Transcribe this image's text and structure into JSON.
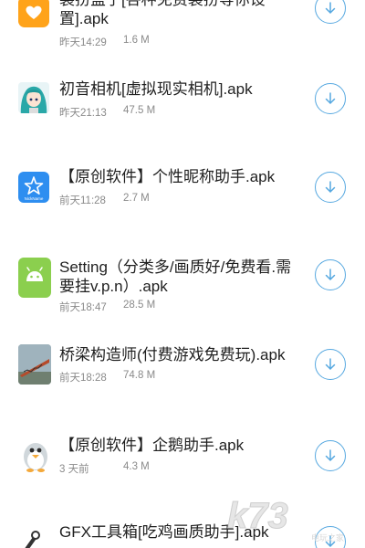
{
  "colors": {
    "accent": "#56a8e0",
    "title_text": "#1f1f1f",
    "meta_text": "#8a8a8a",
    "icon_heart_bg": "#ffa31a",
    "icon_star_bg": "#2e8ef0",
    "icon_android_bg": "#8bcf4e"
  },
  "apps": [
    {
      "title": "装扮盒子[各种免费装扮等你设置].apk",
      "time": "昨天14:29",
      "size": "1.6 M",
      "icon": "heart-icon"
    },
    {
      "title": "初音相机[虚拟现实相机].apk",
      "time": "昨天21:13",
      "size": "47.5 M",
      "icon": "hatsune-avatar-icon"
    },
    {
      "title": "【原创软件】个性昵称助手.apk",
      "time": "前天11:28",
      "size": "2.7 M",
      "icon": "nickname-star-icon",
      "icon_caption": "NickName"
    },
    {
      "title": "Setting（分类多/画质好/免费看.需要挂v.p.n）.apk",
      "time": "前天18:47",
      "size": "28.5 M",
      "icon": "android-icon"
    },
    {
      "title": "桥梁构造师(付费游戏免费玩).apk",
      "time": "前天18:28",
      "size": "74.8 M",
      "icon": "bridge-game-icon"
    },
    {
      "title": "【原创软件】企鹅助手.apk",
      "time": "3 天前",
      "size": "4.3 M",
      "icon": "penguin-icon"
    },
    {
      "title": "GFX工具箱[吃鸡画质助手].apk",
      "time": "",
      "size": "",
      "icon": "gfx-tool-icon"
    }
  ],
  "watermark": {
    "text": "k73",
    "subtext": "电玩之家"
  }
}
